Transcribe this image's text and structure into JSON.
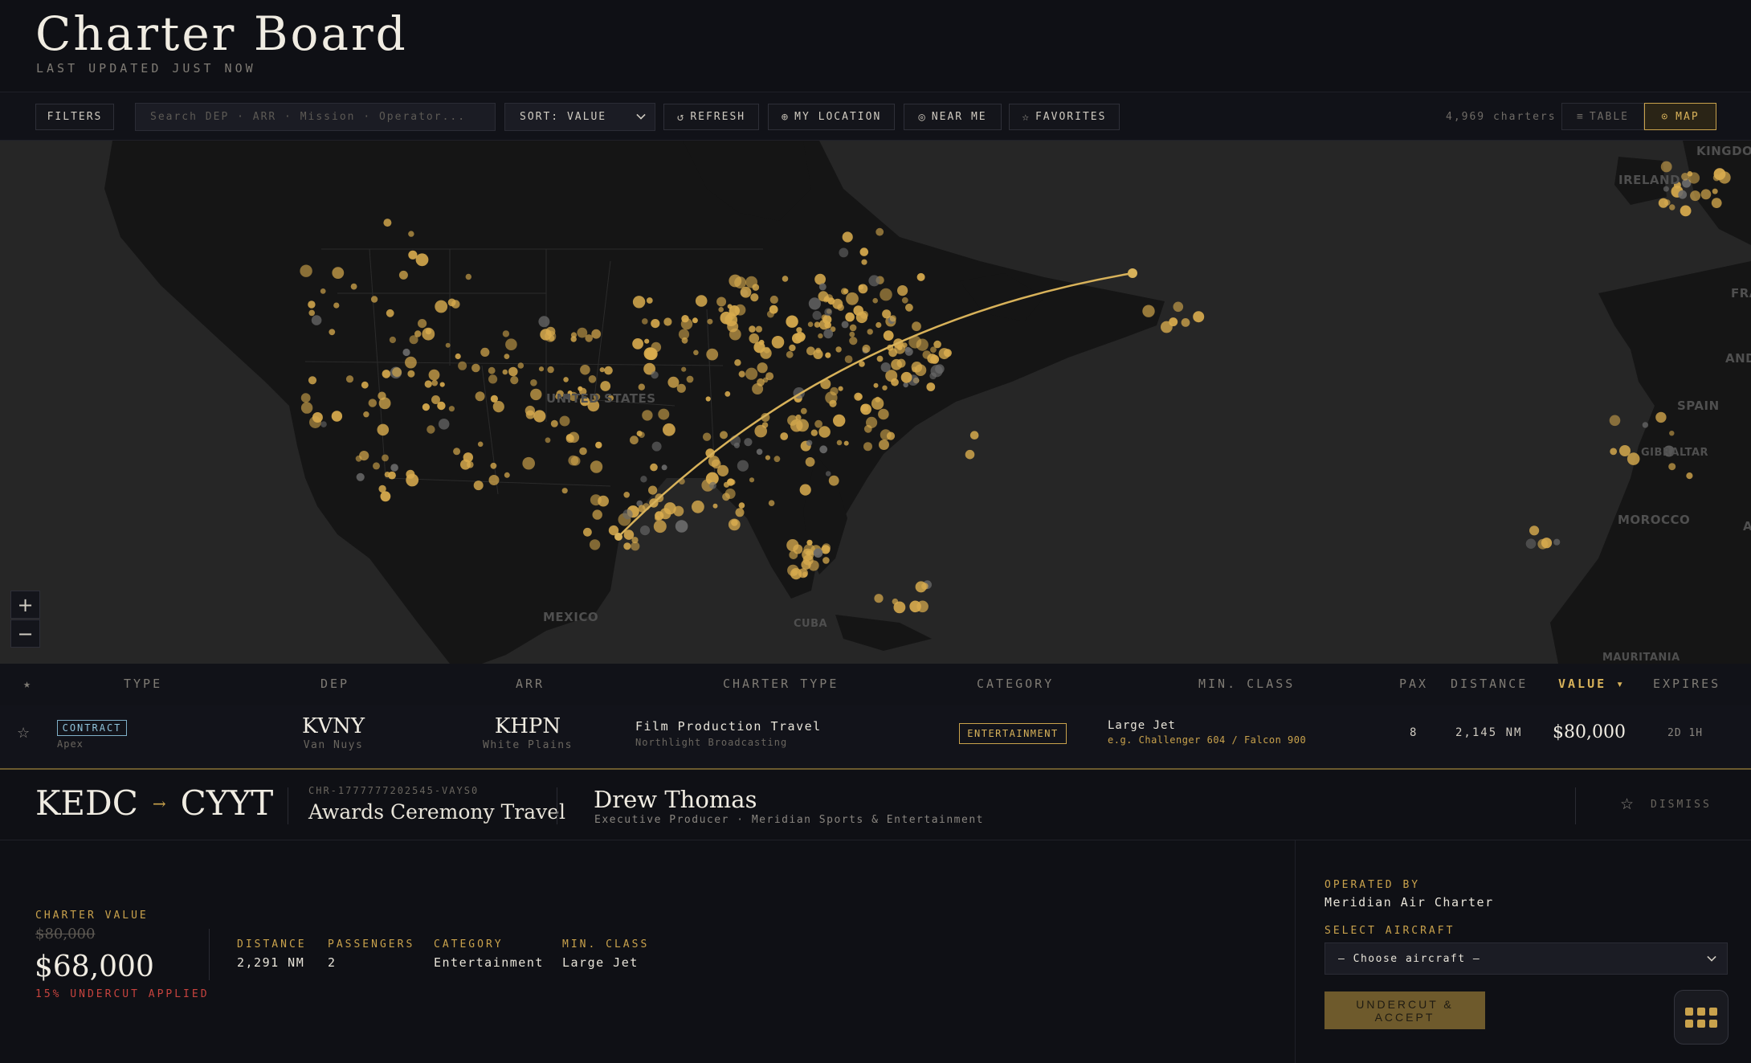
{
  "header": {
    "title": "Charter Board",
    "updated": "LAST UPDATED JUST NOW"
  },
  "toolbar": {
    "filters_label": "FILTERS",
    "search_placeholder": "Search DEP · ARR · Mission · Operator...",
    "sort_value": "SORT: VALUE",
    "refresh_label": "REFRESH",
    "my_location_label": "MY LOCATION",
    "near_me_label": "NEAR ME",
    "favorites_label": "FAVORITES",
    "count": "4,969 charters",
    "view_table_label": "TABLE",
    "view_map_label": "MAP",
    "active_view": "map"
  },
  "map": {
    "labels": {
      "us": "UNITED STATES",
      "mexico": "MEXICO",
      "cuba": "CUBA",
      "ireland": "IRELAND",
      "kingdom": "KINGDOM",
      "spain": "SPAIN",
      "gibraltar": "GIBRALTAR",
      "morocco": "MOROCCO",
      "mauritania": "MAURITANIA",
      "fra": "FRA",
      "and": "AND",
      "a": "A"
    },
    "zoom_in": "+",
    "zoom_out": "−",
    "marker_color": "#d8ab4e",
    "route_color": "#d8b25a"
  },
  "table": {
    "headers": {
      "fav": "★",
      "type": "TYPE",
      "dep": "DEP",
      "arr": "ARR",
      "charter_type": "CHARTER TYPE",
      "category": "CATEGORY",
      "min_class": "MIN. CLASS",
      "pax": "PAX",
      "distance": "DISTANCE",
      "value": "VALUE ▾",
      "expires": "EXPIRES"
    },
    "rows": [
      {
        "fav": "☆",
        "type": "CONTRACT",
        "operator": "Apex",
        "dep": "KVNY",
        "dep_city": "Van Nuys",
        "arr": "KHPN",
        "arr_city": "White Plains",
        "charter_type": "Film Production Travel",
        "client": "Northlight Broadcasting",
        "category": "ENTERTAINMENT",
        "min_class": "Large Jet",
        "aircraft_example": "e.g. Challenger 604 / Falcon 900",
        "pax": "8",
        "distance": "2,145 NM",
        "value": "$80,000",
        "expires": "2D 1H"
      }
    ]
  },
  "detail": {
    "dep": "KEDC",
    "arrow": "→",
    "arr": "CYYT",
    "id": "CHR-1777777202545-VAYS0",
    "mission": "Awards Ceremony Travel",
    "contact_name": "Drew Thomas",
    "contact_role": "Executive Producer · Meridian Sports & Entertainment",
    "fav": "☆",
    "dismiss": "DISMISS",
    "charter_value_label": "CHARTER VALUE",
    "original_value": "$80,000",
    "value": "$68,000",
    "undercut_note": "15% UNDERCUT APPLIED",
    "distance_label": "DISTANCE",
    "distance": "2,291 NM",
    "passengers_label": "PASSENGERS",
    "passengers": "2",
    "category_label": "CATEGORY",
    "category": "Entertainment",
    "min_class_label": "MIN. CLASS",
    "min_class": "Large Jet",
    "operated_by_label": "OPERATED BY",
    "operator": "Meridian Air Charter",
    "select_aircraft_label": "SELECT AIRCRAFT",
    "aircraft_select": "— Choose aircraft —",
    "accept_label": "UNDERCUT & ACCEPT"
  }
}
